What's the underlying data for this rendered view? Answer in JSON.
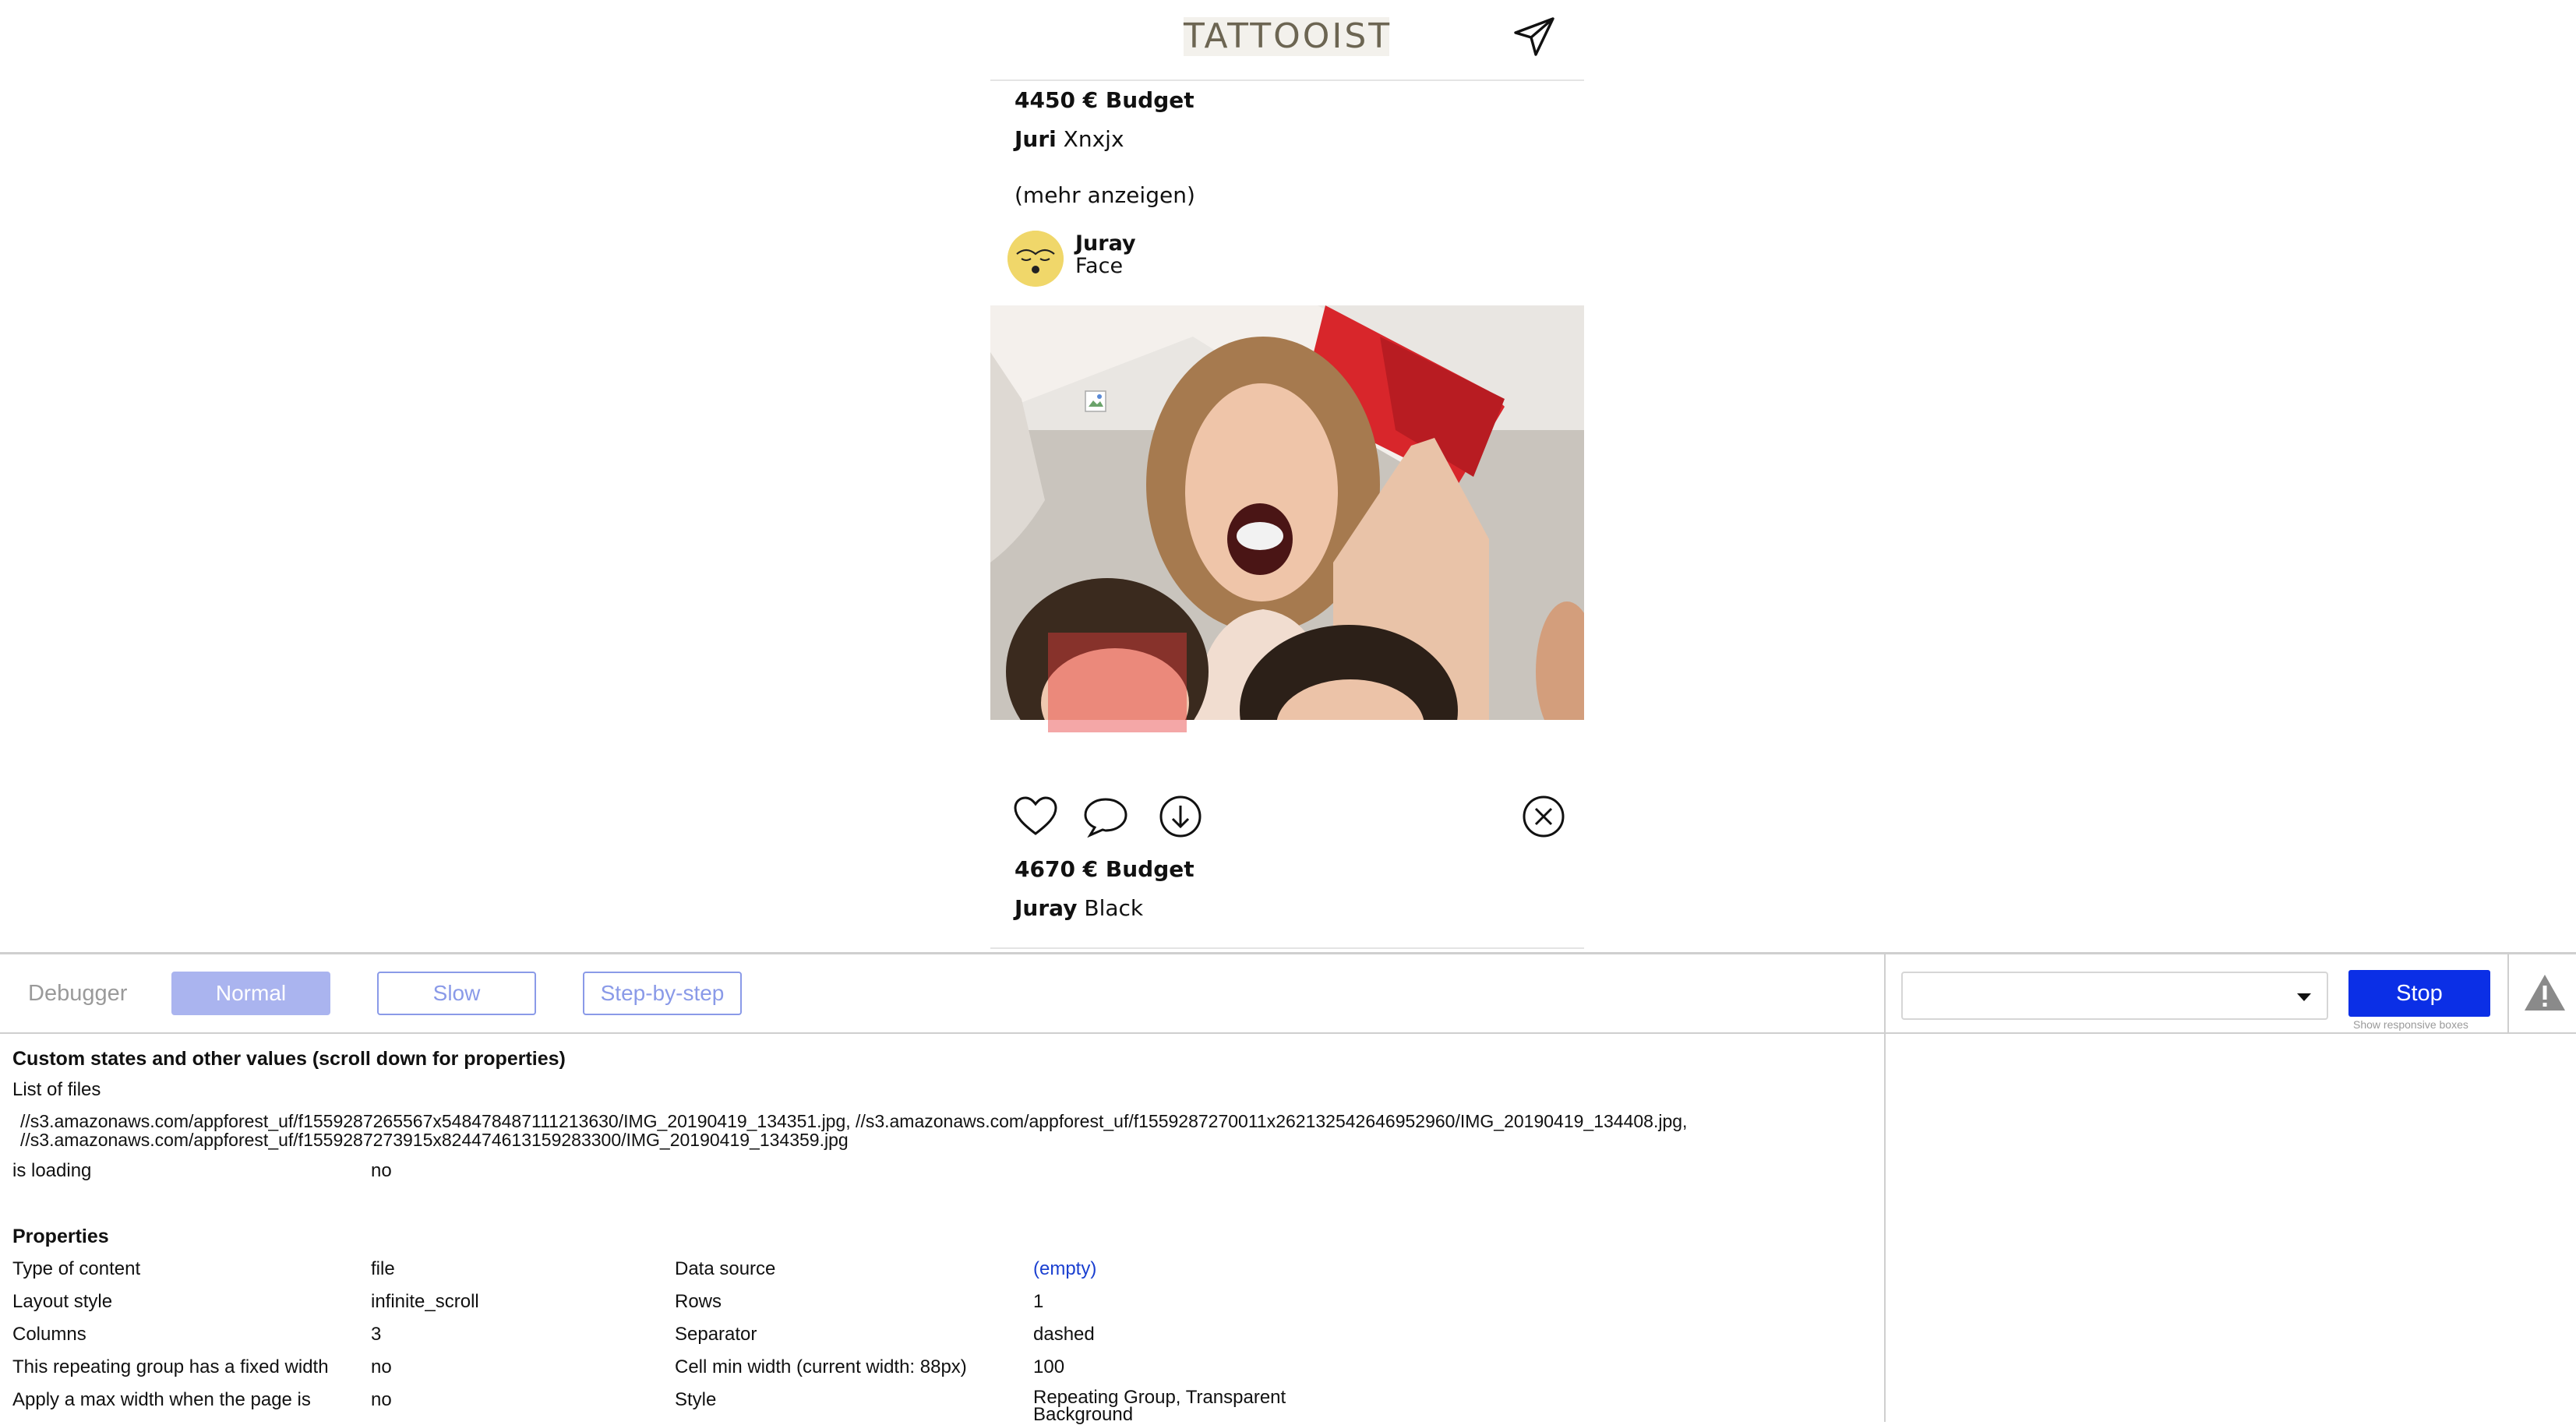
{
  "app": {
    "logo_text": "TATTOOIST",
    "post_top": {
      "budget": "4450 € Budget",
      "client_first": "Juri",
      "client_last": "Xnxjx",
      "more_link": "(mehr anzeigen)"
    },
    "artist": {
      "name": "Juray",
      "style": "Face"
    },
    "post_bottom": {
      "budget": "4670 € Budget",
      "client_first": "Juray",
      "client_last": "Black"
    },
    "icons": [
      "send-icon",
      "heart-icon",
      "comment-icon",
      "download-icon",
      "close-circle-icon"
    ]
  },
  "debugger": {
    "title": "Debugger",
    "modes": [
      "Normal",
      "Slow",
      "Step-by-step"
    ],
    "active_mode": "Normal",
    "select_value": "",
    "stop_label": "Stop",
    "responsive_label": "Show responsive boxes",
    "custom_states_title": "Custom states and other values (scroll down for properties)",
    "list_of_files_label": "List of files",
    "files_line1": "//s3.amazonaws.com/appforest_uf/f1559287265567x548478487111213630/IMG_20190419_134351.jpg, //s3.amazonaws.com/appforest_uf/f1559287270011x262132542646952960/IMG_20190419_134408.jpg,",
    "files_line2": "//s3.amazonaws.com/appforest_uf/f1559287273915x824474613159283300/IMG_20190419_134359.jpg",
    "is_loading_label": "is loading",
    "is_loading_value": "no",
    "properties_title": "Properties",
    "properties": [
      {
        "label": "Type of content",
        "value": "file",
        "label2": "Data source",
        "value2": "(empty)"
      },
      {
        "label": "Layout style",
        "value": "infinite_scroll",
        "label2": "Rows",
        "value2": "1"
      },
      {
        "label": "Columns",
        "value": "3",
        "label2": "Separator",
        "value2": "dashed"
      },
      {
        "label": "This repeating group has a fixed width",
        "value": "no",
        "label2": "Cell min width (current width: 88px)",
        "value2": "100"
      },
      {
        "label": "Apply a max width when the page is",
        "value": "no",
        "label2": "Style",
        "value2": "Repeating Group, Transparent Background"
      }
    ]
  }
}
